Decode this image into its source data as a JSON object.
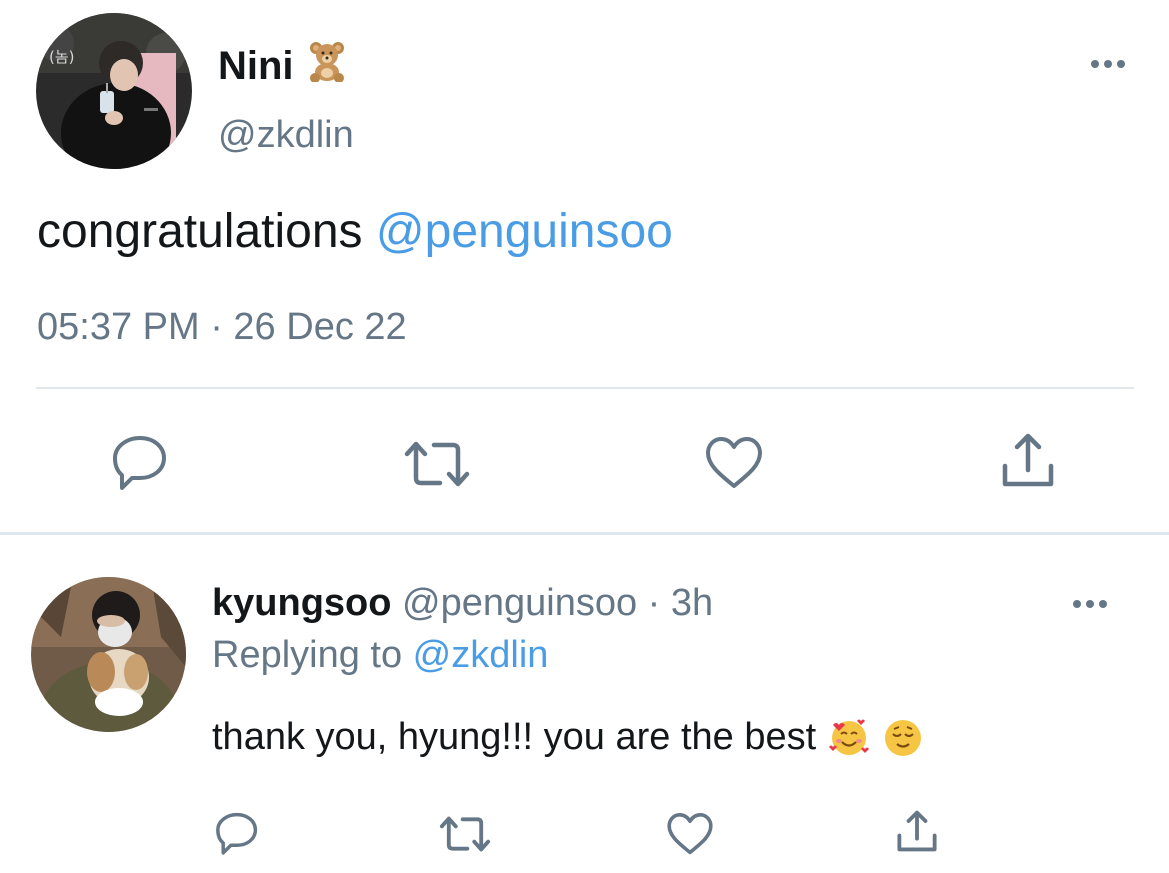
{
  "tweet": {
    "display_name": "Nini",
    "name_emoji": "teddy-bear-emoji",
    "handle": "@zkdlin",
    "text_plain": "congratulations ",
    "text_mention": "@penguinsoo",
    "timestamp": "05:37 PM · 26 Dec 22",
    "avatar_badge": "(놈)"
  },
  "actions": {
    "icons": [
      "reply-icon",
      "retweet-icon",
      "like-icon",
      "share-icon"
    ]
  },
  "reply": {
    "name": "kyungsoo",
    "handle_time": " @penguinsoo · 3h",
    "replying_label": "Replying to ",
    "replying_mention": "@zkdlin",
    "text": "thank you, hyung!!! you are the best",
    "emojis": [
      "smiling-face-with-hearts-emoji",
      "relieved-face-emoji"
    ]
  },
  "colors": {
    "accent": "#4a9de5",
    "secondary_text": "#657786",
    "primary_text": "#14171a",
    "divider": "#e1e8ed"
  }
}
